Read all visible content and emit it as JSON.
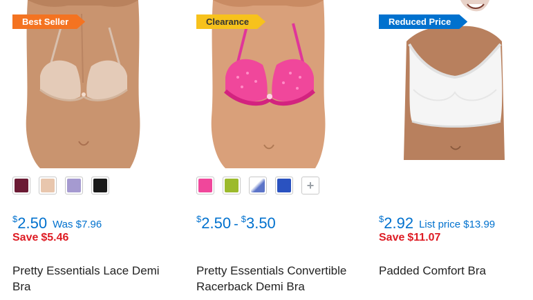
{
  "products": [
    {
      "badge": "Best Seller",
      "badge_color": "#f47321",
      "image_icon": "lace-demi-bra-photo",
      "swatches": [
        "#6b1a34",
        "#e8c6ad",
        "#a59ad0",
        "#1a1a1a"
      ],
      "price_currency": "$",
      "price": "2.50",
      "was_text": "Was $7.96",
      "save_label": "Save",
      "save_amount": "$5.46",
      "title": "Pretty Essentials Lace Demi Bra"
    },
    {
      "badge": "Clearance",
      "badge_color": "#f7c21c",
      "image_icon": "convertible-racerback-bra-photo",
      "swatches": [
        "#f0479b",
        "#9cba2c",
        "#5c74c8",
        "#2a52c0"
      ],
      "more_swatch_icon": "plus-icon",
      "price_currency": "$",
      "price_low": "2.50",
      "range_sep": "-",
      "price_high": "3.50",
      "title": "Pretty Essentials Convertible Racerback Demi Bra"
    },
    {
      "badge": "Reduced Price",
      "badge_color": "#0071ce",
      "image_icon": "padded-comfort-bra-photo",
      "price_currency": "$",
      "price": "2.92",
      "was_text": "List price $13.99",
      "save_label": "Save",
      "save_amount": "$11.07",
      "title": "Padded Comfort Bra"
    }
  ]
}
